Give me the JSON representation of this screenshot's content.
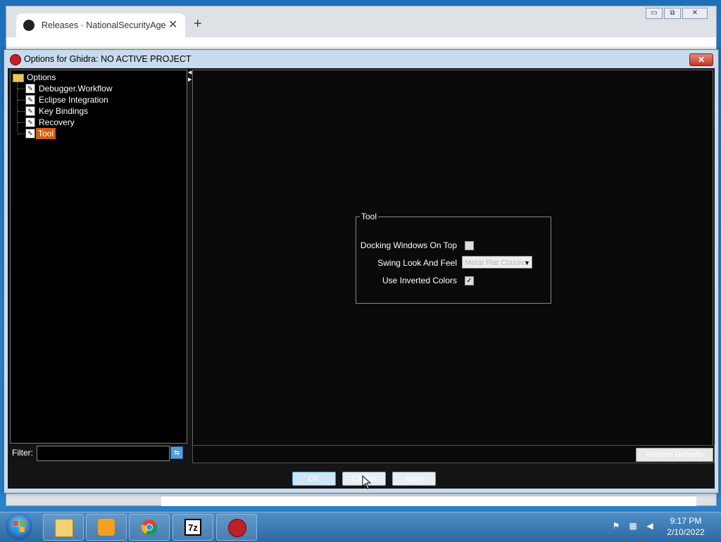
{
  "browser": {
    "tab_title": "Releases · NationalSecurityAgency",
    "new_tab_symbol": "+",
    "close_symbol": "✕",
    "win_minimize": "▭",
    "win_restore": "⧉",
    "win_close": "✕"
  },
  "dialog": {
    "title": "Options for Ghidra: NO ACTIVE PROJECT",
    "close_symbol": "✕",
    "tree": {
      "root": "Options",
      "items": [
        "Debugger.Workflow",
        "Eclipse Integration",
        "Key Bindings",
        "Recovery",
        "Tool"
      ],
      "selected_index": 4
    },
    "filter_label": "Filter:",
    "filter_value": "",
    "group": {
      "title": "Tool",
      "docking_label": "Docking Windows On Top",
      "docking_checked": false,
      "laf_label": "Swing Look And Feel",
      "laf_value": "Metal Flat Classic",
      "inverted_label": "Use Inverted Colors",
      "inverted_checked": true
    },
    "restore_defaults_label": "Restore Defaults",
    "buttons": {
      "ok": "OK",
      "cancel": "Cancel",
      "apply": "Apply"
    }
  },
  "taskbar": {
    "apps": [
      "explorer-icon",
      "media-player-icon",
      "chrome-icon",
      "7zip-icon",
      "ghidra-icon"
    ],
    "sevenzip_text": "7z",
    "time": "9:17 PM",
    "date": "2/10/2022"
  },
  "colors": {
    "selection": "#d35e0d",
    "desktop": "#2a7fc8"
  }
}
